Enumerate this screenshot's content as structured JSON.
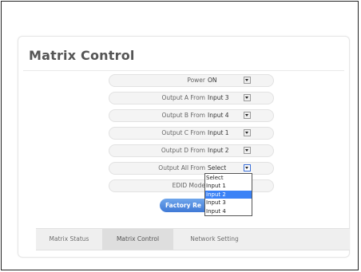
{
  "page": {
    "title": "Matrix Control"
  },
  "rows": [
    {
      "label": "Power",
      "value": "ON"
    },
    {
      "label": "Output A From",
      "value": "Input 3"
    },
    {
      "label": "Output B From",
      "value": "Input 4"
    },
    {
      "label": "Output C From",
      "value": "Input 1"
    },
    {
      "label": "Output D From",
      "value": "Input 2"
    },
    {
      "label": "Output All From",
      "value": "Select"
    },
    {
      "label": "EDID Mode",
      "value": ""
    }
  ],
  "dropdown": {
    "options": [
      "Select",
      "Input 1",
      "Input 2",
      "Input 3",
      "Input 4"
    ],
    "highlighted": "Input 2"
  },
  "buttons": {
    "factory_reset_label": "Factory Re"
  },
  "tabs": [
    {
      "label": "Matrix Status",
      "active": false
    },
    {
      "label": "Matrix Control",
      "active": true
    },
    {
      "label": "Network Setting",
      "active": false
    }
  ],
  "colors": {
    "accent": "#3f79d6",
    "dropdown_highlight": "#3b82f6"
  },
  "icons": {
    "dropdown_arrow": "chevron-down-icon"
  }
}
